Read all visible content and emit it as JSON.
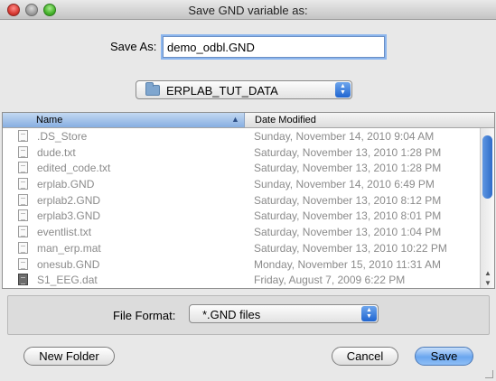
{
  "window": {
    "title": "Save GND variable as:"
  },
  "save_as": {
    "label": "Save As:",
    "value": "demo_odbl.GND"
  },
  "folder": {
    "name": "ERPLAB_TUT_DATA",
    "icon": "folder-icon"
  },
  "file_list": {
    "columns": [
      "Name",
      "Date Modified"
    ],
    "sort_column": "Name",
    "rows": [
      {
        "name": ".DS_Store",
        "date": "Sunday, November 14, 2010 9:04 AM",
        "icon": "document-icon"
      },
      {
        "name": "dude.txt",
        "date": "Saturday, November 13, 2010 1:28 PM",
        "icon": "document-icon"
      },
      {
        "name": "edited_code.txt",
        "date": "Saturday, November 13, 2010 1:28 PM",
        "icon": "document-icon"
      },
      {
        "name": "erplab.GND",
        "date": "Sunday, November 14, 2010 6:49 PM",
        "icon": "document-icon"
      },
      {
        "name": "erplab2.GND",
        "date": "Saturday, November 13, 2010 8:12 PM",
        "icon": "document-icon"
      },
      {
        "name": "erplab3.GND",
        "date": "Saturday, November 13, 2010 8:01 PM",
        "icon": "document-icon"
      },
      {
        "name": "eventlist.txt",
        "date": "Saturday, November 13, 2010 1:04 PM",
        "icon": "document-icon"
      },
      {
        "name": "man_erp.mat",
        "date": "Saturday, November 13, 2010 10:22 PM",
        "icon": "document-icon"
      },
      {
        "name": "onesub.GND",
        "date": "Monday, November 15, 2010 11:31 AM",
        "icon": "document-icon"
      },
      {
        "name": "S1_EEG.dat",
        "date": "Friday, August 7, 2009 6:22 PM",
        "icon": "application-icon"
      }
    ]
  },
  "file_format": {
    "label": "File Format:",
    "value": "*.GND files"
  },
  "buttons": {
    "new_folder": "New Folder",
    "cancel": "Cancel",
    "save": "Save"
  },
  "colors": {
    "accent": "#3f7bd8",
    "disabled_text": "#8b8b8b"
  }
}
